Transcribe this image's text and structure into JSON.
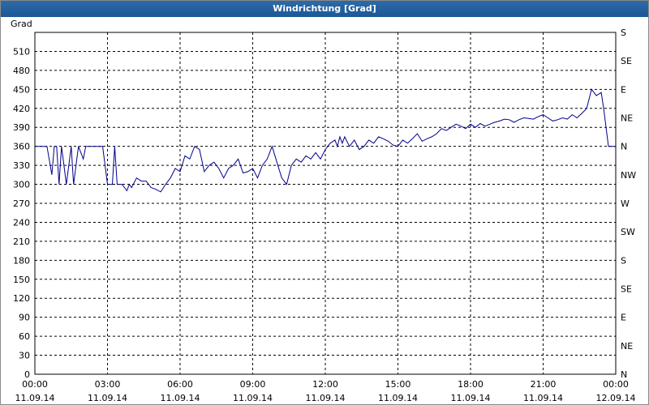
{
  "window": {
    "title": "Windrichtung [Grad]"
  },
  "chart_data": {
    "type": "line",
    "title": "Windrichtung [Grad]",
    "ylabel": "Grad",
    "xlabel": "",
    "ylim": [
      0,
      540
    ],
    "xlim_hours": [
      0,
      24
    ],
    "grid": true,
    "line_color": "#00008b",
    "y_ticks": [
      30,
      60,
      90,
      120,
      150,
      180,
      210,
      240,
      270,
      300,
      330,
      360,
      390,
      420,
      450,
      480,
      510
    ],
    "y_right_ticks": [
      {
        "value": 0,
        "label": "N"
      },
      {
        "value": 45,
        "label": "NE"
      },
      {
        "value": 90,
        "label": "E"
      },
      {
        "value": 135,
        "label": "SE"
      },
      {
        "value": 180,
        "label": "S"
      },
      {
        "value": 225,
        "label": "SW"
      },
      {
        "value": 270,
        "label": "W"
      },
      {
        "value": 315,
        "label": "NW"
      },
      {
        "value": 360,
        "label": "N"
      },
      {
        "value": 405,
        "label": "NE"
      },
      {
        "value": 450,
        "label": "E"
      },
      {
        "value": 495,
        "label": "SE"
      },
      {
        "value": 540,
        "label": "S"
      }
    ],
    "x_ticks": [
      {
        "hour": 0,
        "time": "00:00",
        "date": "11.09.14"
      },
      {
        "hour": 3,
        "time": "03:00",
        "date": "11.09.14"
      },
      {
        "hour": 6,
        "time": "06:00",
        "date": "11.09.14"
      },
      {
        "hour": 9,
        "time": "09:00",
        "date": "11.09.14"
      },
      {
        "hour": 12,
        "time": "12:00",
        "date": "11.09.14"
      },
      {
        "hour": 15,
        "time": "15:00",
        "date": "11.09.14"
      },
      {
        "hour": 18,
        "time": "18:00",
        "date": "11.09.14"
      },
      {
        "hour": 21,
        "time": "21:00",
        "date": "11.09.14"
      },
      {
        "hour": 24,
        "time": "00:00",
        "date": "12.09.14"
      }
    ],
    "series": [
      {
        "x": [
          0,
          0.5,
          0.7,
          0.8,
          0.9,
          1.0,
          1.1,
          1.3,
          1.5,
          1.6,
          1.8,
          2.0,
          2.1,
          2.3,
          2.5,
          2.8,
          3.0,
          3.1,
          3.2,
          3.3,
          3.4,
          3.5,
          3.6,
          3.8,
          3.9,
          4.0,
          4.2,
          4.4,
          4.6,
          4.8,
          5.0,
          5.2,
          5.4,
          5.6,
          5.8,
          6.0,
          6.2,
          6.4,
          6.6,
          6.8,
          7.0,
          7.2,
          7.4,
          7.6,
          7.8,
          8.0,
          8.2,
          8.4,
          8.6,
          8.8,
          9.0,
          9.2,
          9.4,
          9.6,
          9.8,
          10.0,
          10.2,
          10.4,
          10.6,
          10.8,
          11.0,
          11.2,
          11.4,
          11.6,
          11.8,
          12.0,
          12.2,
          12.4,
          12.5,
          12.6,
          12.7,
          12.8,
          13.0,
          13.2,
          13.4,
          13.6,
          13.8,
          14.0,
          14.2,
          14.4,
          14.6,
          14.8,
          15.0,
          15.2,
          15.4,
          15.6,
          15.8,
          16.0,
          16.2,
          16.4,
          16.6,
          16.8,
          17.0,
          17.2,
          17.4,
          17.6,
          17.8,
          18.0,
          18.2,
          18.4,
          18.6,
          18.8,
          19.0,
          19.2,
          19.4,
          19.6,
          19.8,
          20.0,
          20.2,
          20.4,
          20.6,
          20.8,
          21.0,
          21.2,
          21.4,
          21.6,
          21.8,
          22.0,
          22.2,
          22.4,
          22.6,
          22.8,
          23.0,
          23.2,
          23.4,
          23.5,
          23.7,
          24.0
        ],
        "y": [
          360,
          360,
          315,
          360,
          360,
          300,
          360,
          300,
          360,
          300,
          360,
          340,
          360,
          360,
          360,
          360,
          300,
          300,
          300,
          360,
          300,
          300,
          300,
          290,
          300,
          295,
          310,
          305,
          305,
          295,
          292,
          288,
          300,
          310,
          325,
          320,
          345,
          340,
          360,
          355,
          320,
          330,
          335,
          325,
          310,
          325,
          330,
          340,
          318,
          320,
          325,
          310,
          330,
          340,
          360,
          335,
          310,
          300,
          330,
          340,
          335,
          345,
          340,
          350,
          340,
          355,
          365,
          370,
          360,
          375,
          365,
          375,
          360,
          370,
          355,
          360,
          370,
          365,
          375,
          372,
          368,
          362,
          360,
          370,
          365,
          372,
          380,
          368,
          372,
          375,
          380,
          388,
          385,
          390,
          395,
          392,
          388,
          395,
          390,
          396,
          392,
          395,
          398,
          400,
          403,
          402,
          398,
          402,
          405,
          404,
          403,
          407,
          410,
          405,
          400,
          402,
          405,
          403,
          410,
          405,
          412,
          420,
          450,
          440,
          445,
          420,
          360,
          360
        ]
      }
    ]
  }
}
